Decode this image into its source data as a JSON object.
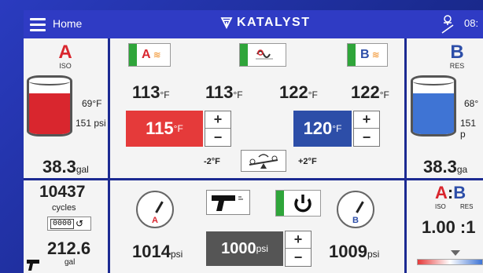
{
  "topbar": {
    "home_label": "Home",
    "brand": "KATALYST",
    "time": "08:"
  },
  "iso": {
    "letter": "A",
    "sub": "ISO",
    "temp": "69°F",
    "pressure": "151 psi",
    "volume": "38.3",
    "volume_unit": "gal",
    "color": "#d9262e"
  },
  "res": {
    "letter": "B",
    "sub": "RES",
    "temp": "68°",
    "pressure": "151 p",
    "volume": "38.3",
    "volume_unit": "ga",
    "color": "#2d4ea8"
  },
  "heaters": {
    "a_temp": "113",
    "hose_temp": "113",
    "b_temp": "122",
    "b2_temp": "122",
    "temp_unit": "°F",
    "a_setpoint": "115",
    "b_setpoint": "120",
    "setpoint_unit": "°F",
    "offset_low": "-2°F",
    "offset_high": "+2°F"
  },
  "cycles": {
    "count": "10437",
    "label": "cycles",
    "counter": "0000",
    "total": "212.6",
    "total_unit": "gal"
  },
  "pressure": {
    "a": "1014",
    "b": "1009",
    "unit": "psi",
    "setpoint": "1000",
    "a_label": "A",
    "b_label": "B"
  },
  "ratio": {
    "a": "A",
    "colon": ":",
    "b": "B",
    "a_sub": "ISO",
    "b_sub": "RES",
    "value": "1.00 :1"
  },
  "colors": {
    "green": "#2fa53a",
    "red": "#d9262e",
    "blue": "#2d4ea8",
    "frame": "#1c2a92"
  }
}
